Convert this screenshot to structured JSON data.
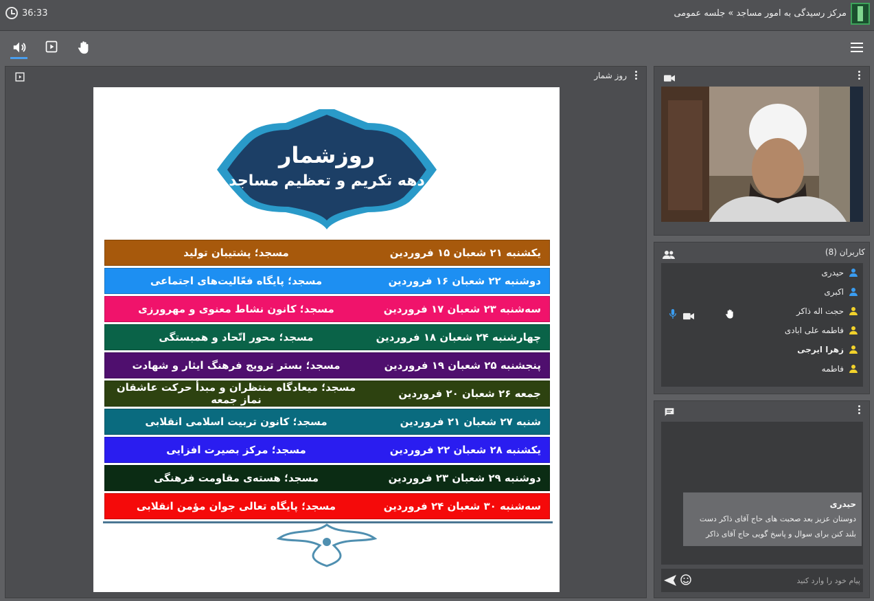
{
  "header": {
    "title": "مرکز رسیدگی به امور مساجد » جلسه عمومی",
    "timer": "36:33"
  },
  "presentation": {
    "title": "روز شمار",
    "badge_line1": "روزشمار",
    "badge_line2": "دهه تکریم و تعظیم مساجد",
    "rows": [
      {
        "date": "یکشنبه ۲۱ شعبان ۱۵ فروردین",
        "topic": "مسجد؛ پشتیبان تولید",
        "color": "#a7590c"
      },
      {
        "date": "دوشنبه ۲۲ شعبان ۱۶ فروردین",
        "topic": "مسجد؛ پایگاه فعّالیت‌های اجتماعی",
        "color": "#1d8ff2"
      },
      {
        "date": "سه‌شنبه ۲۳ شعبان ۱۷ فروردین",
        "topic": "مسجد؛ کانون نشاط معنوی و مهرورزی",
        "color": "#f0136b"
      },
      {
        "date": "چهارشنبه ۲۴ شعبان ۱۸ فروردین",
        "topic": "مسجد؛ محور اتّحاد و همبستگی",
        "color": "#0a6348"
      },
      {
        "date": "پنجشنبه ۲۵ شعبان ۱۹ فروردین",
        "topic": "مسجد؛ بستر ترویج فرهنگ ایثار و شهادت",
        "color": "#4f0f6e"
      },
      {
        "date": "جمعه ۲۶ شعبان ۲۰ فروردین",
        "topic": "مسجد؛ میعادگاه منتظران و مبدأ حرکت عاشقان نماز جمعه",
        "color": "#2d4210"
      },
      {
        "date": "شنبه ۲۷ شعبان ۲۱ فروردین",
        "topic": "مسجد؛ کانون تربیت اسلامی انقلابی",
        "color": "#0a6b7f"
      },
      {
        "date": "یکشنبه ۲۸ شعبان ۲۲ فروردین",
        "topic": "مسجد؛ مرکز بصیرت افزایی",
        "color": "#2a1df0"
      },
      {
        "date": "دوشنبه ۲۹ شعبان ۲۳ فروردین",
        "topic": "مسجد؛ هسته‌ی مقاومت فرهنگی",
        "color": "#0b2c14"
      },
      {
        "date": "سه‌شنبه ۳۰ شعبان ۲۴ فروردین",
        "topic": "مسجد؛ پایگاه تعالی جوان مؤمن انقلابی",
        "color": "#f50a0a"
      }
    ]
  },
  "users": {
    "title": "کاربران (8)",
    "list": [
      {
        "name": "حیدری",
        "color": "#3a9cf0",
        "bold": false
      },
      {
        "name": "اکبری",
        "color": "#3a9cf0",
        "bold": false
      },
      {
        "name": "حجت اله ذاکر",
        "color": "#f2d22b",
        "bold": false
      },
      {
        "name": "فاطمه علی ابادی",
        "color": "#f2d22b",
        "bold": false
      },
      {
        "name": "زهرا ایرجی",
        "color": "#f2d22b",
        "bold": true
      },
      {
        "name": "فاطمه",
        "color": "#f2d22b",
        "bold": false
      }
    ]
  },
  "chat": {
    "author": "حیدری",
    "message": "دوستان عزیز بعد صحبت های حاج آقای ذاکر دست بلند کنن برای سوال و پاسخ گویی حاج آقای ذاکر",
    "placeholder": "پیام خود را وارد کنید"
  }
}
